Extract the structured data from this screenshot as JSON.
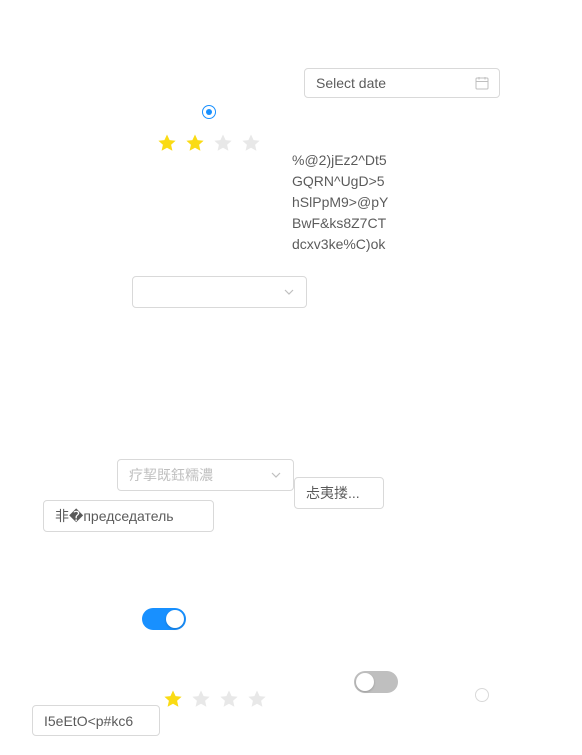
{
  "date_picker": {
    "placeholder": "Select date",
    "icon": "calendar-icon"
  },
  "radio_top": {
    "checked": true
  },
  "rating_top": {
    "value": 2,
    "max": 4
  },
  "text_block": {
    "lines": [
      "%@2)jEz2^Dt5",
      "GQRN^UgD>5",
      "hSlPpM9>@pY",
      "BwF&ks8Z7CT",
      "dcxv3ke%C)ok"
    ]
  },
  "select_empty": {
    "value": ""
  },
  "select_placeholder": {
    "placeholder": "疗挈既鈺糯濃"
  },
  "button_right": {
    "label": "忐夷搂..."
  },
  "button_left": {
    "label": "非�председатель"
  },
  "switch_on": {
    "checked": true
  },
  "switch_off": {
    "checked": false
  },
  "rating_bottom": {
    "value": 1,
    "max": 4
  },
  "radio_bottom": {
    "checked": false
  },
  "text_button_bottom": {
    "label": "I5eEtO<p#kc6"
  },
  "colors": {
    "accent": "#1890ff",
    "star": "#fadb14",
    "star_empty": "#e8e8e8"
  }
}
